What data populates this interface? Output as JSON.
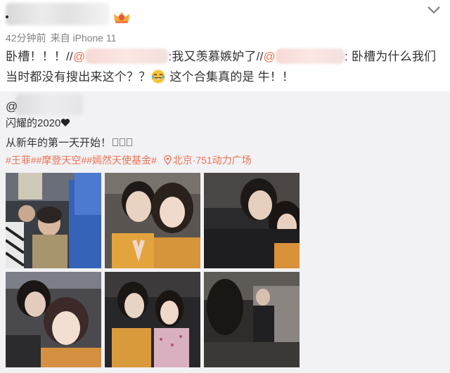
{
  "post": {
    "time": "42分钟前",
    "source": "来自 iPhone 11",
    "text_a": "卧槽！！！//",
    "at_1": "@",
    "text_b": ":我又羡慕嫉妒了//",
    "at_2": "@",
    "text_c": ": 卧槽为什么我们",
    "text_d": "当时都没有搜出来这个？？",
    "text_e": " 这个合集真的是 牛！！"
  },
  "original": {
    "at": "@",
    "line1": "闪耀的2020",
    "line2": "从新年的第一天开始！",
    "tags": [
      "#王菲#",
      "#摩登天空#",
      "#嫣然天使基金#"
    ],
    "location": "北京·751动力广场"
  },
  "icons": {
    "vip": "vip-crown-badge-icon",
    "chevron": "chevron-down-icon",
    "emoji": "laughing-tears-emoji-icon",
    "heart": "black-heart-icon",
    "location": "map-pin-icon"
  },
  "colors": {
    "link": "#eb7350",
    "meta": "#808080",
    "repost_bg": "#f2f2f5",
    "text": "#333333"
  }
}
